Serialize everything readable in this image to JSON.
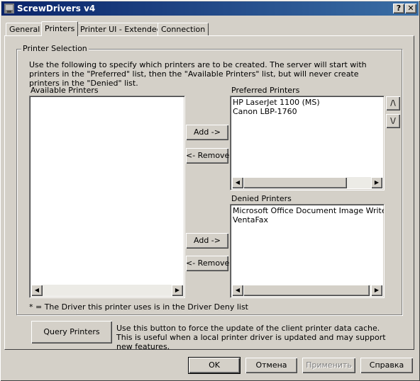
{
  "window": {
    "title": "ScrewDrivers v4",
    "help_button": "?",
    "close_button": "✕"
  },
  "tabs": [
    {
      "label": "General"
    },
    {
      "label": "Printers"
    },
    {
      "label": "Printer UI - Extended"
    },
    {
      "label": "Connection"
    }
  ],
  "printer_selection": {
    "group_label": "Printer Selection",
    "description": "Use the following to specify which printers are to be created.  The server will start with printers in the \"Preferred\" list, then the \"Available Printers\" list, but will never create printers in the \"Denied\" list.",
    "available_label": "Available Printers",
    "available_items": [],
    "preferred_label": "Preferred Printers",
    "preferred_items": [
      "HP LaserJet 1100 (MS)",
      "Canon LBP-1760"
    ],
    "denied_label": "Denied Printers",
    "denied_items": [
      "Microsoft Office Document Image Writer",
      "VentaFax"
    ],
    "add_preferred_label": "Add ->",
    "remove_preferred_label": "<- Remove",
    "add_denied_label": "Add ->",
    "remove_denied_label": "<- Remove",
    "move_up_label": "/\\",
    "move_down_label": "\\/",
    "note": "* = The Driver this printer uses is in the Driver Deny list"
  },
  "query": {
    "button_label": "Query Printers",
    "description": "Use this button to force the update of the client printer data cache.  This is useful when a local printer driver is updated and may support new features."
  },
  "footer": {
    "ok_label": "OK",
    "cancel_label": "Отмена",
    "apply_label": "Применить",
    "help_label": "Справка"
  }
}
